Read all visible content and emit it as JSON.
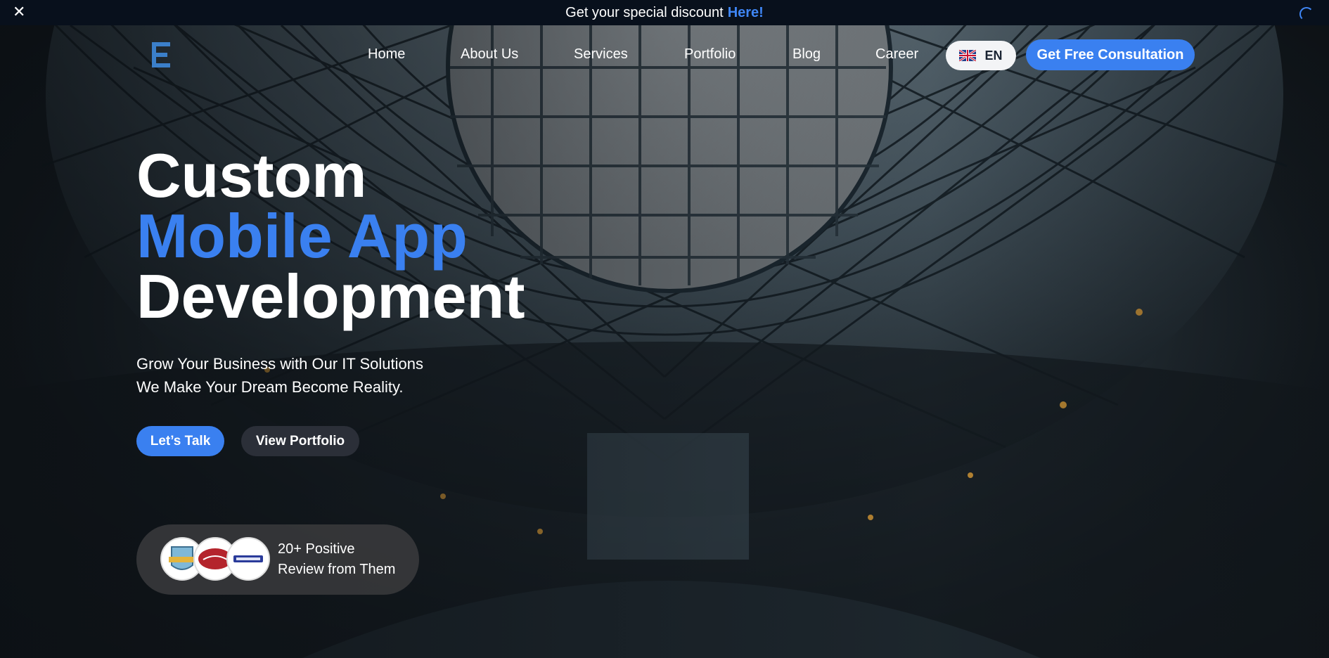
{
  "announcement": {
    "text": "Get your special discount",
    "link": "Here!"
  },
  "nav": {
    "items": [
      "Home",
      "About Us",
      "Services",
      "Portfolio",
      "Blog",
      "Career"
    ],
    "language": "EN",
    "cta": "Get Free Consultation"
  },
  "hero": {
    "line1": "Custom",
    "line2": "Mobile App",
    "line3": "Development",
    "subtitle1": "Grow Your Business with Our IT Solutions",
    "subtitle2": "We Make Your Dream Become Reality.",
    "primary_button": "Let’s Talk",
    "secondary_button": "View Portfolio",
    "reviews_line1": "20+ Positive",
    "reviews_line2": "Review from Them"
  },
  "colors": {
    "accent": "#3a80f0",
    "topbar": "#08101c"
  }
}
